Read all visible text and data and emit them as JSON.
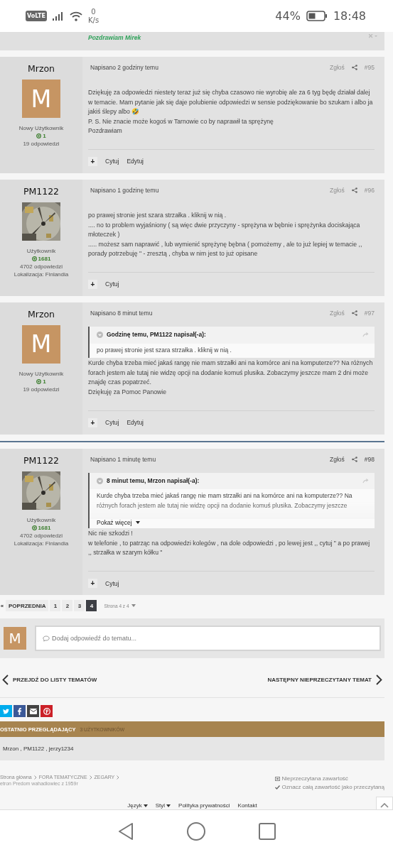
{
  "status_bar": {
    "network_badge": "VoLTE",
    "speed_value": "0",
    "speed_unit": "K/s",
    "battery_percent": "44%",
    "time": "18:48"
  },
  "previous_post": {
    "signature": "Pozdrawiam Mirek"
  },
  "posts": [
    {
      "author": "Mrzon",
      "avatar": {
        "kind": "letter",
        "letter": "M"
      },
      "rank": "Nowy Użytkownik",
      "reputation": "1",
      "answers": "19 odpowiedzi",
      "date": "Napisano 2 godziny temu",
      "report": "Zgłoś",
      "report_faded": true,
      "number": "#95",
      "body": [
        "Dziękuję za odpowiedzi niestety teraz już się chyba czasowo nie wyrobię ale za 6 tyg będę działał dalej w temacie. Mam pytanie jak się daje polubienie odpowiedzi w sensie podziękowanie bo szukam i albo ja jakiś ślepy albo 🤣",
        "P. S. Nie znacie może kogoś w Tarnowie co by naprawił ta sprężynę",
        "Pozdrawiam"
      ],
      "actions": [
        "Cytuj",
        "Edytuj"
      ],
      "plus": "+"
    },
    {
      "author": "PM1122",
      "avatar": {
        "kind": "picture"
      },
      "rank": "Użytkownik",
      "reputation": "1681",
      "answers": "4702 odpowiedzi",
      "location": "Lokalizacja: Finlandia",
      "date": "Napisano 1 godzinę temu",
      "report": "Zgłoś",
      "report_faded": true,
      "number": "#96",
      "body": [
        "po prawej stronie jest szara strzałka . kliknij w nią .",
        ".... no to problem wyjaśniony ( są więc dwie przyczyny - sprężyna w bębnie i sprężynka dociskająca młoteczek )",
        "..... możesz sam naprawić , lub wymienić sprężynę bębna ( pomożemy , ale to już lepiej w temacie ,, porady potrzebuję \" - zresztą , chyba w nim jest to już opisane"
      ],
      "actions": [
        "Cytuj"
      ],
      "plus": "+"
    },
    {
      "author": "Mrzon",
      "avatar": {
        "kind": "letter",
        "letter": "M"
      },
      "rank": "Nowy Użytkownik",
      "reputation": "1",
      "answers": "19 odpowiedzi",
      "date": "Napisano 8 minut temu",
      "report": "Zgłoś",
      "report_faded": true,
      "number": "#97",
      "quote": {
        "header": "Godzinę temu, PM1122 napisał(-a):",
        "text": "po prawej stronie jest szara strzałka . kliknij w nią .",
        "collapsed": false
      },
      "body": [
        "Kurde chyba trzeba mieć jakaś rangę nie mam strzałki ani na komórce ani na komputerze?? Na różnych forach jestem ale tutaj nie widzę opcji na dodanie komuś plusika. Zobaczymy jeszcze mam 2 dni może znajdę czas popatrzeć.",
        "Dziękuję za Pomoc Panowie"
      ],
      "actions": [
        "Cytuj",
        "Edytuj"
      ],
      "plus": "+"
    },
    {
      "author": "PM1122",
      "avatar": {
        "kind": "picture"
      },
      "rank": "Użytkownik",
      "reputation": "1681",
      "answers": "4702 odpowiedzi",
      "location": "Lokalizacja: Finlandia",
      "date": "Napisano 1 minutę temu",
      "report": "Zgłoś",
      "report_faded": false,
      "number": "#98",
      "new_marker": true,
      "quote": {
        "header": "8 minut temu, Mrzon napisał(-a):",
        "text": "Kurde chyba trzeba mieć jakaś rangę nie mam strzałki ani na komórce ani na komputerze?? Na różnych forach jestem ale tutaj nie widzę opcji na dodanie komuś plusika. Zobaczymy jeszcze",
        "collapsed": true,
        "show_more": "Pokaż więcej"
      },
      "body": [
        "Nic nie szkodzi !",
        "w telefonie , to patrząc na odpowiedzi kolegów , na dole odpowiedzi , po lewej jest ,, cytuj \" a po prawej ,, strzałka w szarym kółku \""
      ],
      "actions": [
        "Cytuj"
      ],
      "plus": "+"
    }
  ],
  "pagination": {
    "first": "«",
    "previous": "POPRZEDNIA",
    "pages": [
      {
        "label": "1",
        "selected": false
      },
      {
        "label": "2",
        "selected": false
      },
      {
        "label": "3",
        "selected": false
      },
      {
        "label": "4",
        "selected": true
      }
    ],
    "page_info": "Strona 4 z 4"
  },
  "reply": {
    "avatar_letter": "M",
    "placeholder": "Dodaj odpowiedź do tematu..."
  },
  "topic_nav": {
    "back": "PRZEJDŹ DO LISTY TEMATÓW",
    "next": "NASTĘPNY NIEPRZECZYTANY TEMAT"
  },
  "share": [
    {
      "kind": "twitter",
      "color": "#00aced"
    },
    {
      "kind": "facebook",
      "color": "#3b5998"
    },
    {
      "kind": "email",
      "color": "#444444"
    },
    {
      "kind": "pinterest",
      "color": "#cb2027"
    }
  ],
  "viewers": {
    "title": "OSTATNIO PRZEGLĄDAJĄCY",
    "count": "3 UŻYTKOWNIKÓW",
    "names": "Mrzon , PM1122 , jerzy1234"
  },
  "breadcrumbs": {
    "items": [
      "Strona główna",
      "FORA TEMATYCZNE",
      "ZEGARY"
    ],
    "current": "etron Predom wahadłowiec z 1959r",
    "unread": "Nieprzeczytana zawartość",
    "mark_read": "Oznacz całą zawartość jako przeczytaną"
  },
  "footer_links": [
    {
      "label": "Język",
      "dropdown": true
    },
    {
      "label": "Styl",
      "dropdown": true
    },
    {
      "label": "Polityka prywatności",
      "dropdown": false
    },
    {
      "label": "Kontakt",
      "dropdown": false
    }
  ]
}
